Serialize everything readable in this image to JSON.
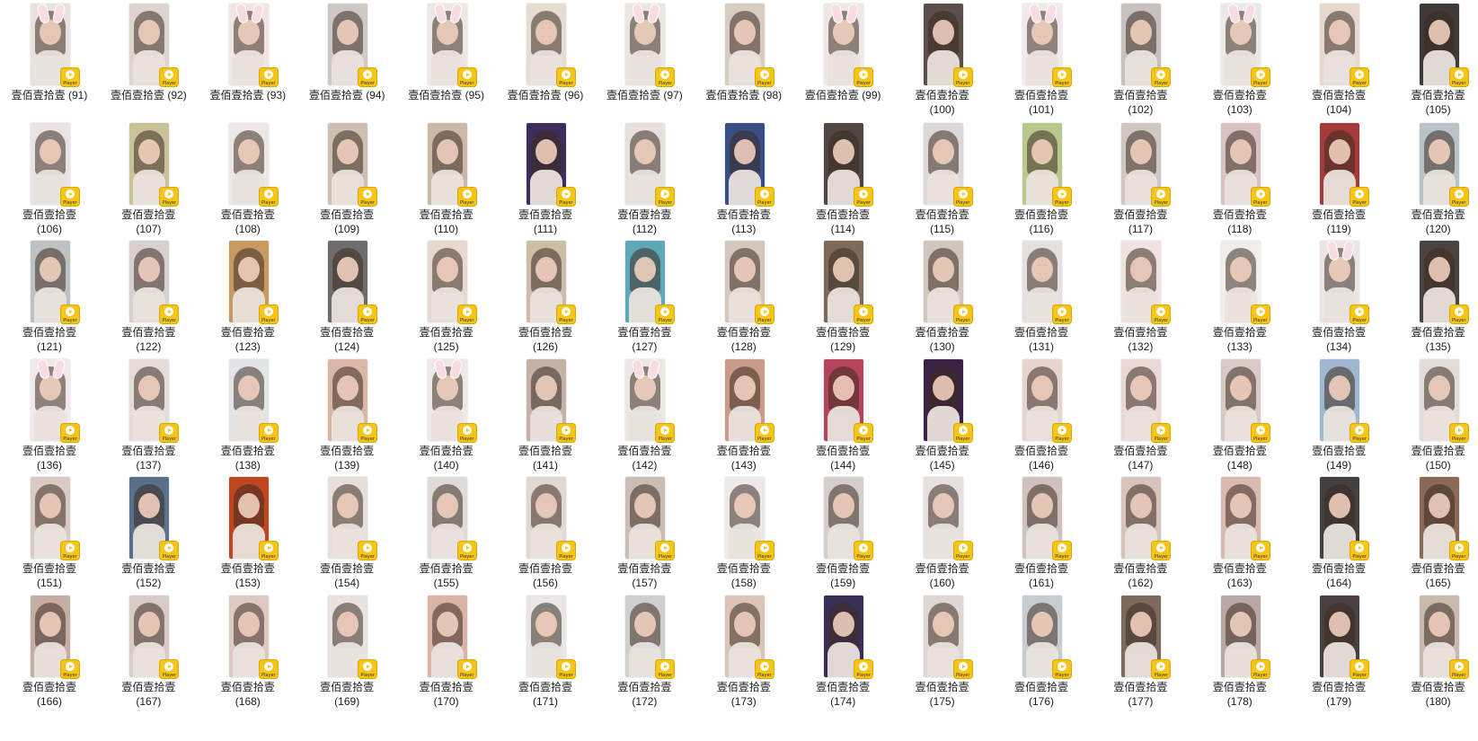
{
  "file_name_prefix": "壹佰壹拾壹",
  "badge_label": "Player",
  "colors": {
    "badge": "#f5c518",
    "background": "#ffffff",
    "text": "#1a1a1a"
  },
  "icon": "player-badge-icon",
  "files": [
    {
      "name": "壹佰壹拾壹",
      "number": "(91)",
      "tone": "#e8e2de",
      "ears": true
    },
    {
      "name": "壹佰壹拾壹",
      "number": "(92)",
      "tone": "#ddd6cf",
      "ears": false
    },
    {
      "name": "壹佰壹拾壹",
      "number": "(93)",
      "tone": "#f2e6e3",
      "ears": true
    },
    {
      "name": "壹佰壹拾壹",
      "number": "(94)",
      "tone": "#cfc9c6",
      "ears": false
    },
    {
      "name": "壹佰壹拾壹",
      "number": "(95)",
      "tone": "#eee8e4",
      "ears": true
    },
    {
      "name": "壹佰壹拾壹",
      "number": "(96)",
      "tone": "#e6dcd2",
      "ears": false
    },
    {
      "name": "壹佰壹拾壹",
      "number": "(97)",
      "tone": "#ece6e2",
      "ears": true
    },
    {
      "name": "壹佰壹拾壹",
      "number": "(98)",
      "tone": "#d8cdc1",
      "ears": false
    },
    {
      "name": "壹佰壹拾壹",
      "number": "(99)",
      "tone": "#efe9e6",
      "ears": true
    },
    {
      "name": "壹佰壹拾壹",
      "number": "(100)",
      "tone": "#5a4f49",
      "ears": false
    },
    {
      "name": "壹佰壹拾壹",
      "number": "(101)",
      "tone": "#f0ebe8",
      "ears": true
    },
    {
      "name": "壹佰壹拾壹",
      "number": "(102)",
      "tone": "#c8c2bf",
      "ears": false
    },
    {
      "name": "壹佰壹拾壹",
      "number": "(103)",
      "tone": "#eceae9",
      "ears": true
    },
    {
      "name": "壹佰壹拾壹",
      "number": "(104)",
      "tone": "#e5d9d0",
      "ears": false
    },
    {
      "name": "壹佰壹拾壹",
      "number": "(105)",
      "tone": "#3f3a37",
      "ears": false
    },
    {
      "name": "壹佰壹拾壹",
      "number": "(106)",
      "tone": "#e9e4e2",
      "ears": false
    },
    {
      "name": "壹佰壹拾壹",
      "number": "(107)",
      "tone": "#c9c39a",
      "ears": false
    },
    {
      "name": "壹佰壹拾壹",
      "number": "(108)",
      "tone": "#ede7e5",
      "ears": false
    },
    {
      "name": "壹佰壹拾壹",
      "number": "(109)",
      "tone": "#cdbfb1",
      "ears": false
    },
    {
      "name": "壹佰壹拾壹",
      "number": "(110)",
      "tone": "#cbb9a7",
      "ears": false
    },
    {
      "name": "壹佰壹拾壹",
      "number": "(111)",
      "tone": "#3c2e5a",
      "ears": false
    },
    {
      "name": "壹佰壹拾壹",
      "number": "(112)",
      "tone": "#e7e0dd",
      "ears": false
    },
    {
      "name": "壹佰壹拾壹",
      "number": "(113)",
      "tone": "#3a4e86",
      "ears": false
    },
    {
      "name": "壹佰壹拾壹",
      "number": "(114)",
      "tone": "#4f4641",
      "ears": false
    },
    {
      "name": "壹佰壹拾壹",
      "number": "(115)",
      "tone": "#dcd9d8",
      "ears": false
    },
    {
      "name": "壹佰壹拾壹",
      "number": "(116)",
      "tone": "#b9c98e",
      "ears": false
    },
    {
      "name": "壹佰壹拾壹",
      "number": "(117)",
      "tone": "#cfc7c1",
      "ears": false
    },
    {
      "name": "壹佰壹拾壹",
      "number": "(118)",
      "tone": "#d9c2c1",
      "ears": false
    },
    {
      "name": "壹佰壹拾壹",
      "number": "(119)",
      "tone": "#a63a3a",
      "ears": false
    },
    {
      "name": "壹佰壹拾壹",
      "number": "(120)",
      "tone": "#b9c3c8",
      "ears": false
    },
    {
      "name": "壹佰壹拾壹",
      "number": "(121)",
      "tone": "#bfc2c2",
      "ears": false
    },
    {
      "name": "壹佰壹拾壹",
      "number": "(122)",
      "tone": "#d8cfd0",
      "ears": false
    },
    {
      "name": "壹佰壹拾壹",
      "number": "(123)",
      "tone": "#c79a63",
      "ears": false
    },
    {
      "name": "壹佰壹拾壹",
      "number": "(124)",
      "tone": "#6f6d6c",
      "ears": false
    },
    {
      "name": "壹佰壹拾壹",
      "number": "(125)",
      "tone": "#e8d9cf",
      "ears": false
    },
    {
      "name": "壹佰壹拾壹",
      "number": "(126)",
      "tone": "#cdbca7",
      "ears": false
    },
    {
      "name": "壹佰壹拾壹",
      "number": "(127)",
      "tone": "#5fa8b8",
      "ears": false
    },
    {
      "name": "壹佰壹拾壹",
      "number": "(128)",
      "tone": "#d4c7bb",
      "ears": false
    },
    {
      "name": "壹佰壹拾壹",
      "number": "(129)",
      "tone": "#7d6a5b",
      "ears": false
    },
    {
      "name": "壹佰壹拾壹",
      "number": "(130)",
      "tone": "#cfc6bd",
      "ears": false
    },
    {
      "name": "壹佰壹拾壹",
      "number": "(131)",
      "tone": "#e5e0dd",
      "ears": false
    },
    {
      "name": "壹佰壹拾壹",
      "number": "(132)",
      "tone": "#eee3de",
      "ears": false
    },
    {
      "name": "壹佰壹拾壹",
      "number": "(133)",
      "tone": "#f1efed",
      "ears": false
    },
    {
      "name": "壹佰壹拾壹",
      "number": "(134)",
      "tone": "#ebe6e4",
      "ears": true
    },
    {
      "name": "壹佰壹拾壹",
      "number": "(135)",
      "tone": "#4b433f",
      "ears": false
    },
    {
      "name": "壹佰壹拾壹",
      "number": "(136)",
      "tone": "#efeae8",
      "ears": true
    },
    {
      "name": "壹佰壹拾壹",
      "number": "(137)",
      "tone": "#e4dcd9",
      "ears": false
    },
    {
      "name": "壹佰壹拾壹",
      "number": "(138)",
      "tone": "#e2e6e6",
      "ears": false
    },
    {
      "name": "壹佰壹拾壹",
      "number": "(139)",
      "tone": "#d9b6a6",
      "ears": false
    },
    {
      "name": "壹佰壹拾壹",
      "number": "(140)",
      "tone": "#eee8e6",
      "ears": true
    },
    {
      "name": "壹佰壹拾壹",
      "number": "(141)",
      "tone": "#c4b2a8",
      "ears": false
    },
    {
      "name": "壹佰壹拾壹",
      "number": "(142)",
      "tone": "#ece7e5",
      "ears": true
    },
    {
      "name": "壹佰壹拾壹",
      "number": "(143)",
      "tone": "#c99c8a",
      "ears": false
    },
    {
      "name": "壹佰壹拾壹",
      "number": "(144)",
      "tone": "#b5435a",
      "ears": false
    },
    {
      "name": "壹佰壹拾壹",
      "number": "(145)",
      "tone": "#3a2146",
      "ears": false
    },
    {
      "name": "壹佰壹拾壹",
      "number": "(146)",
      "tone": "#e6d4cf",
      "ears": false
    },
    {
      "name": "壹佰壹拾壹",
      "number": "(147)",
      "tone": "#e9d8d6",
      "ears": false
    },
    {
      "name": "壹佰壹拾壹",
      "number": "(148)",
      "tone": "#d8cbc5",
      "ears": false
    },
    {
      "name": "壹佰壹拾壹",
      "number": "(149)",
      "tone": "#9fb7cf",
      "ears": false
    },
    {
      "name": "壹佰壹拾壹",
      "number": "(150)",
      "tone": "#e2dcd8",
      "ears": false
    },
    {
      "name": "壹佰壹拾壹",
      "number": "(151)",
      "tone": "#d9cbc4",
      "ears": false
    },
    {
      "name": "壹佰壹拾壹",
      "number": "(152)",
      "tone": "#5a6f8a",
      "ears": false
    },
    {
      "name": "壹佰壹拾壹",
      "number": "(153)",
      "tone": "#c2451f",
      "ears": false
    },
    {
      "name": "壹佰壹拾壹",
      "number": "(154)",
      "tone": "#e7dfda",
      "ears": false
    },
    {
      "name": "壹佰壹拾壹",
      "number": "(155)",
      "tone": "#dedad7",
      "ears": false
    },
    {
      "name": "壹佰壹拾壹",
      "number": "(156)",
      "tone": "#e2d8d2",
      "ears": false
    },
    {
      "name": "壹佰壹拾壹",
      "number": "(157)",
      "tone": "#c9bdb5",
      "ears": false
    },
    {
      "name": "壹佰壹拾壹",
      "number": "(158)",
      "tone": "#ecebea",
      "ears": false
    },
    {
      "name": "壹佰壹拾壹",
      "number": "(159)",
      "tone": "#d5cfcc",
      "ears": false
    },
    {
      "name": "壹佰壹拾壹",
      "number": "(160)",
      "tone": "#e5e1df",
      "ears": false
    },
    {
      "name": "壹佰壹拾壹",
      "number": "(161)",
      "tone": "#cfc2bc",
      "ears": false
    },
    {
      "name": "壹佰壹拾壹",
      "number": "(162)",
      "tone": "#d7c4bd",
      "ears": false
    },
    {
      "name": "壹佰壹拾壹",
      "number": "(163)",
      "tone": "#d9b9b0",
      "ears": false
    },
    {
      "name": "壹佰壹拾壹",
      "number": "(164)",
      "tone": "#444040",
      "ears": false
    },
    {
      "name": "壹佰壹拾壹",
      "number": "(165)",
      "tone": "#8b6a55",
      "ears": false
    },
    {
      "name": "壹佰壹拾壹",
      "number": "(166)",
      "tone": "#c5ada3",
      "ears": false
    },
    {
      "name": "壹佰壹拾壹",
      "number": "(167)",
      "tone": "#d7ccc6",
      "ears": false
    },
    {
      "name": "壹佰壹拾壹",
      "number": "(168)",
      "tone": "#dfc9c3",
      "ears": false
    },
    {
      "name": "壹佰壹拾壹",
      "number": "(169)",
      "tone": "#e8e3df",
      "ears": false
    },
    {
      "name": "壹佰壹拾壹",
      "number": "(170)",
      "tone": "#d9b3a5",
      "ears": false
    },
    {
      "name": "壹佰壹拾壹",
      "number": "(171)",
      "tone": "#e9e7e5",
      "ears": false
    },
    {
      "name": "壹佰壹拾壹",
      "number": "(172)",
      "tone": "#cfd0cd",
      "ears": false
    },
    {
      "name": "壹佰壹拾壹",
      "number": "(173)",
      "tone": "#dcc5b8",
      "ears": false
    },
    {
      "name": "壹佰壹拾壹",
      "number": "(174)",
      "tone": "#3a2f55",
      "ears": false
    },
    {
      "name": "壹佰壹拾壹",
      "number": "(175)",
      "tone": "#ddd8d3",
      "ears": false
    },
    {
      "name": "壹佰壹拾壹",
      "number": "(176)",
      "tone": "#c7ccd0",
      "ears": false
    },
    {
      "name": "壹佰壹拾壹",
      "number": "(177)",
      "tone": "#7c6a5e",
      "ears": false
    },
    {
      "name": "壹佰壹拾壹",
      "number": "(178)",
      "tone": "#b9a9a4",
      "ears": false
    },
    {
      "name": "壹佰壹拾壹",
      "number": "(179)",
      "tone": "#4a4040",
      "ears": false
    },
    {
      "name": "壹佰壹拾壹",
      "number": "(180)",
      "tone": "#c8b9ad",
      "ears": false
    }
  ]
}
